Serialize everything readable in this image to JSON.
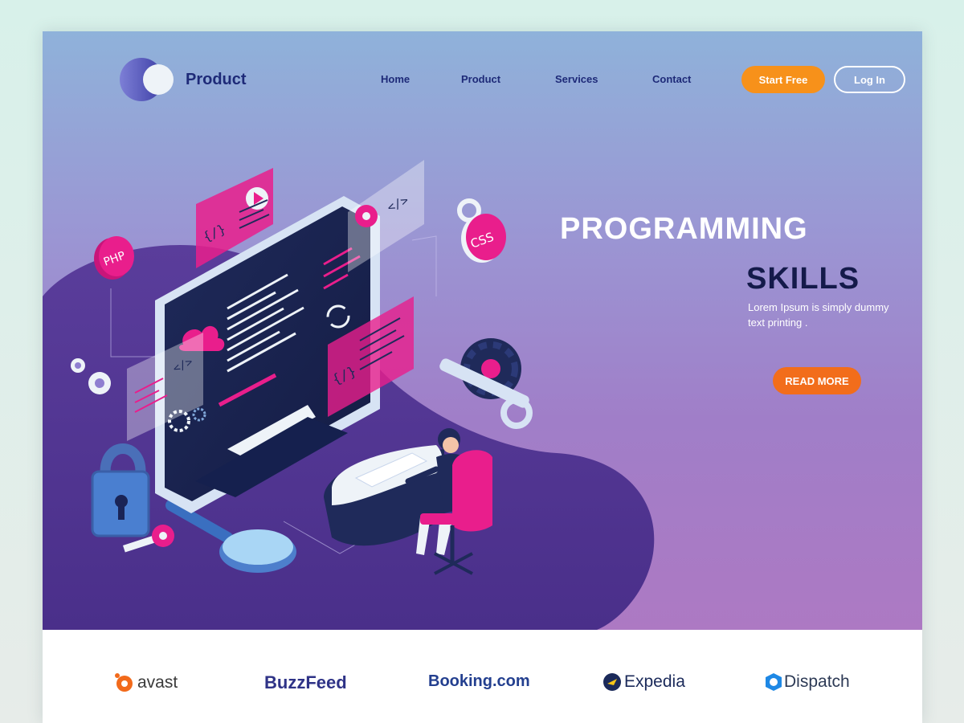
{
  "brand": {
    "name": "Product"
  },
  "nav": {
    "items": [
      {
        "label": "Home"
      },
      {
        "label": "Product"
      },
      {
        "label": "Services"
      },
      {
        "label": "Contact"
      }
    ],
    "start_label": "Start Free",
    "login_label": "Log In"
  },
  "hero": {
    "title_line1": "PROGRAMMING",
    "title_line2": "SKILLS",
    "description": "Lorem Ipsum is simply dummy text printing .",
    "cta_label": "READ MORE",
    "illustration": {
      "code_tags": [
        "{/}",
        "</>",
        "</>",
        "{/}"
      ],
      "badges": [
        "PHP",
        "CSS"
      ]
    }
  },
  "partners": {
    "items": [
      {
        "label": "avast",
        "icon": "avast-logo-icon",
        "color": "#f26a1b"
      },
      {
        "label": "BuzzFeed",
        "icon": "",
        "color": "#2f3387"
      },
      {
        "label": "Booking.com",
        "icon": "",
        "color": "#233f8f",
        "accent": "#2ea3dd"
      },
      {
        "label": "Expedia",
        "icon": "expedia-globe-icon",
        "color": "#1b2a5a"
      },
      {
        "label": "Dispatch",
        "icon": "dispatch-logo-icon",
        "color": "#2d3a55",
        "accent": "#1e88e5"
      }
    ]
  },
  "colors": {
    "accent_orange": "#f7911a",
    "cta_orange": "#f26d1b",
    "navy": "#1e2a78",
    "magenta": "#e91e8c",
    "hero_blob": "#4e3490"
  }
}
